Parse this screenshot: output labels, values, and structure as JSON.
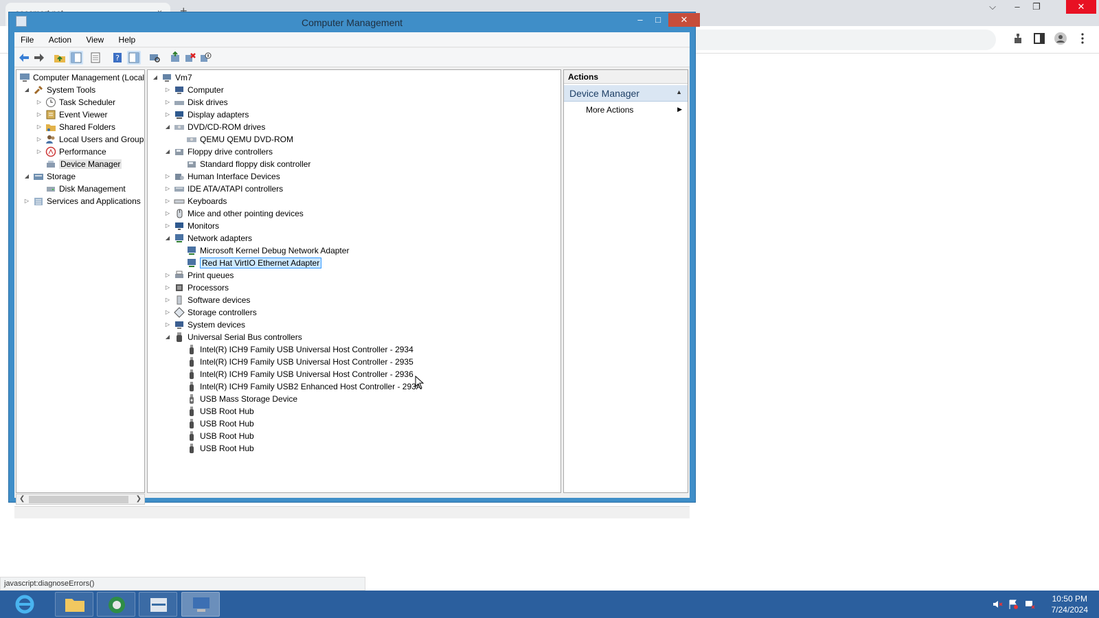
{
  "browser": {
    "tab_title": "eoesmart.net",
    "tab_close": "×",
    "new_tab": "+",
    "status_link": "javascript:diagnoseErrors()",
    "controls": {
      "dropdown": "⌵",
      "minimize": "–",
      "restore": "❐",
      "close": "✕"
    }
  },
  "window": {
    "title": "Computer Management",
    "controls": {
      "minimize": "–",
      "maximize": "□",
      "close": "✕"
    }
  },
  "menu": [
    "File",
    "Action",
    "View",
    "Help"
  ],
  "left_tree": {
    "root": "Computer Management (Local",
    "items": [
      {
        "label": "System Tools",
        "level": 1
      },
      {
        "label": "Task Scheduler",
        "level": 2
      },
      {
        "label": "Event Viewer",
        "level": 2
      },
      {
        "label": "Shared Folders",
        "level": 2
      },
      {
        "label": "Local Users and Groups",
        "level": 2
      },
      {
        "label": "Performance",
        "level": 2
      },
      {
        "label": "Device Manager",
        "level": 2
      },
      {
        "label": "Storage",
        "level": 1
      },
      {
        "label": "Disk Management",
        "level": 2
      },
      {
        "label": "Services and Applications",
        "level": 1
      }
    ]
  },
  "device_tree": {
    "root": "Vm7",
    "rows": [
      {
        "label": "Computer",
        "level": 1
      },
      {
        "label": "Disk drives",
        "level": 1
      },
      {
        "label": "Display adapters",
        "level": 1
      },
      {
        "label": "DVD/CD-ROM drives",
        "level": 1
      },
      {
        "label": "QEMU QEMU DVD-ROM",
        "level": 2
      },
      {
        "label": "Floppy drive controllers",
        "level": 1
      },
      {
        "label": "Standard floppy disk controller",
        "level": 2
      },
      {
        "label": "Human Interface Devices",
        "level": 1
      },
      {
        "label": "IDE ATA/ATAPI controllers",
        "level": 1
      },
      {
        "label": "Keyboards",
        "level": 1
      },
      {
        "label": "Mice and other pointing devices",
        "level": 1
      },
      {
        "label": "Monitors",
        "level": 1
      },
      {
        "label": "Network adapters",
        "level": 1
      },
      {
        "label": "Microsoft Kernel Debug Network Adapter",
        "level": 2
      },
      {
        "label": "Red Hat VirtIO Ethernet Adapter",
        "level": 2
      },
      {
        "label": "Print queues",
        "level": 1
      },
      {
        "label": "Processors",
        "level": 1
      },
      {
        "label": "Software devices",
        "level": 1
      },
      {
        "label": "Storage controllers",
        "level": 1
      },
      {
        "label": "System devices",
        "level": 1
      },
      {
        "label": "Universal Serial Bus controllers",
        "level": 1
      },
      {
        "label": "Intel(R) ICH9 Family USB Universal Host Controller - 2934",
        "level": 2
      },
      {
        "label": "Intel(R) ICH9 Family USB Universal Host Controller - 2935",
        "level": 2
      },
      {
        "label": "Intel(R) ICH9 Family USB Universal Host Controller - 2936",
        "level": 2
      },
      {
        "label": "Intel(R) ICH9 Family USB2 Enhanced Host Controller - 293A",
        "level": 2
      },
      {
        "label": "USB Mass Storage Device",
        "level": 2
      },
      {
        "label": "USB Root Hub",
        "level": 2
      },
      {
        "label": "USB Root Hub",
        "level": 2
      },
      {
        "label": "USB Root Hub",
        "level": 2
      },
      {
        "label": "USB Root Hub",
        "level": 2
      }
    ]
  },
  "actions": {
    "header": "Actions",
    "group": "Device Manager",
    "item": "More Actions"
  },
  "taskbar": {
    "clock_time": "10:50 PM",
    "clock_date": "7/24/2024"
  }
}
